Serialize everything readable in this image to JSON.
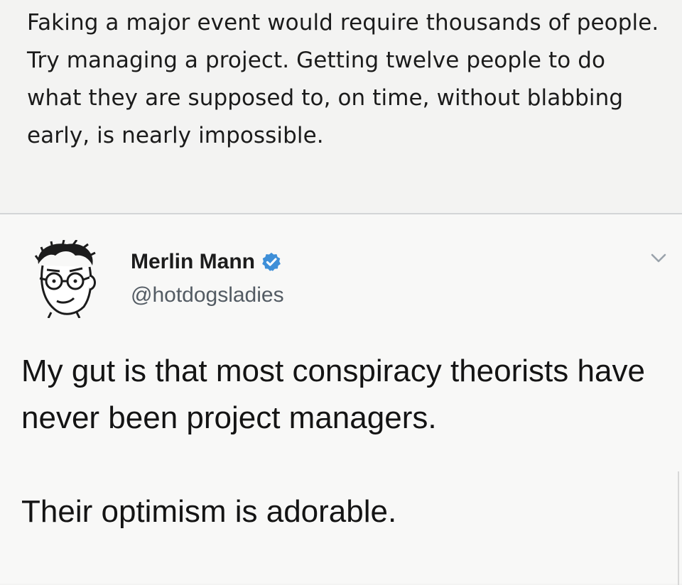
{
  "quote_text": "Faking a major event would require thousands of people.  Try managing a project.  Getting twelve people to do what they are supposed to, on time, without blabbing early, is nearly impossible.",
  "tweet": {
    "author_name": "Merlin Mann",
    "handle": "@hotdogsladies",
    "verified_icon": "verified-badge-icon",
    "menu_icon": "chevron-down-icon",
    "paragraphs": [
      "My gut is that most conspiracy theorists have never been project managers.",
      "Their optimism is adorable."
    ]
  },
  "colors": {
    "background": "#f3f3f2",
    "verified": "#3e8fd8",
    "handle": "#535b63"
  }
}
